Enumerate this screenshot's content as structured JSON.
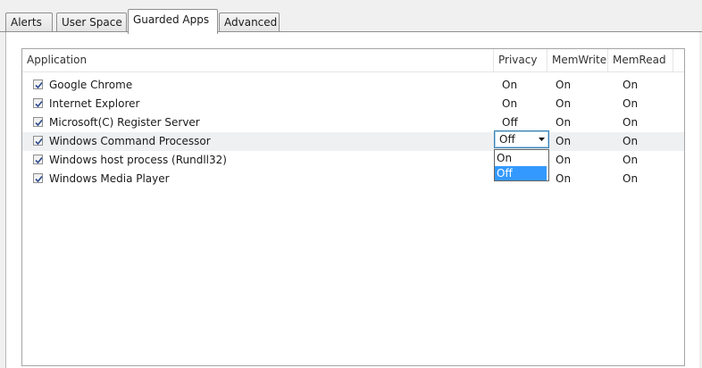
{
  "tabs": [
    {
      "label": "Alerts",
      "active": false
    },
    {
      "label": "User Space",
      "active": false
    },
    {
      "label": "Guarded Apps",
      "active": true
    },
    {
      "label": "Advanced",
      "active": false
    }
  ],
  "columns": {
    "application": "Application",
    "privacy": "Privacy",
    "memwrite": "MemWrite",
    "memread": "MemRead"
  },
  "rows": [
    {
      "name": "Google Chrome",
      "checked": true,
      "privacy": "On",
      "memwrite": "On",
      "memread": "On"
    },
    {
      "name": "Internet Explorer",
      "checked": true,
      "privacy": "On",
      "memwrite": "On",
      "memread": "On"
    },
    {
      "name": "Microsoft(C) Register Server",
      "checked": true,
      "privacy": "Off",
      "memwrite": "On",
      "memread": "On"
    },
    {
      "name": "Windows Command Processor",
      "checked": true,
      "privacy": "Off",
      "memwrite": "On",
      "memread": "On"
    },
    {
      "name": "Windows host process (Rundll32)",
      "checked": true,
      "privacy": "",
      "memwrite": "On",
      "memread": "On"
    },
    {
      "name": "Windows Media Player",
      "checked": true,
      "privacy": "",
      "memwrite": "On",
      "memread": "On"
    }
  ],
  "dropdown": {
    "value": "Off",
    "options": [
      "On",
      "Off"
    ],
    "selected_option": "Off"
  },
  "colors": {
    "selection": "#3399ff",
    "focus_border": "#3c7fb1"
  }
}
